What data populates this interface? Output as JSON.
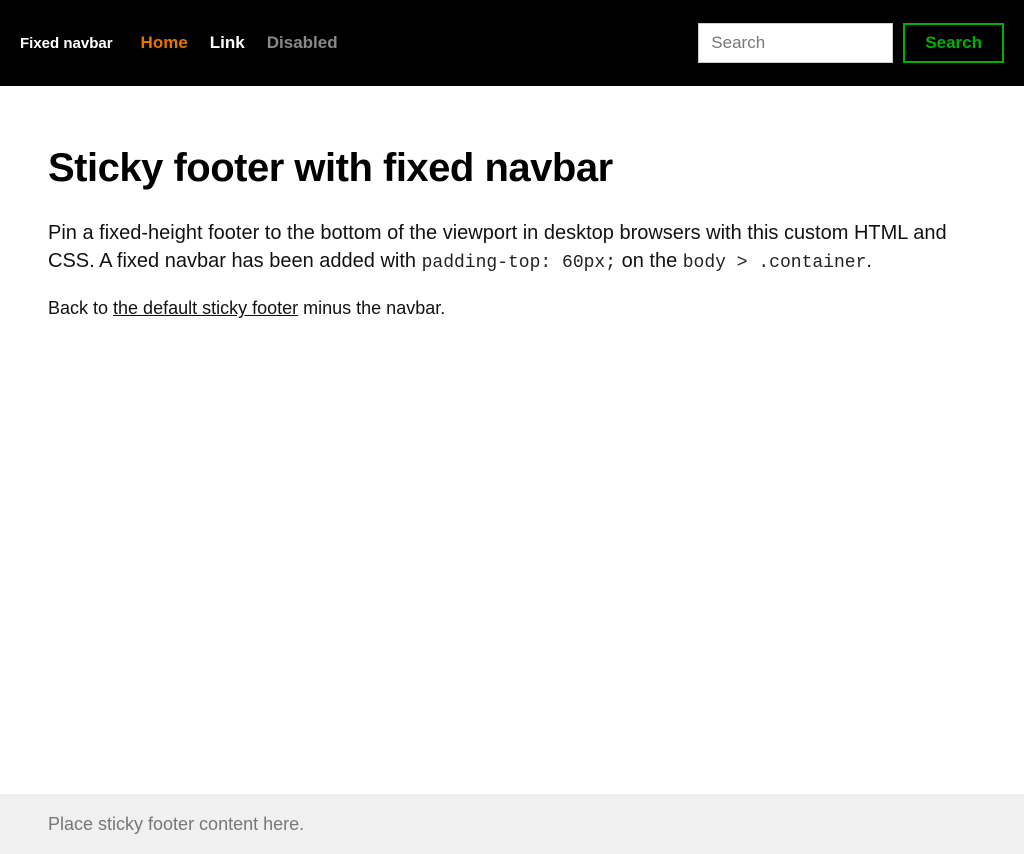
{
  "navbar": {
    "brand": "Fixed navbar",
    "links": [
      {
        "label": "Home",
        "state": "active"
      },
      {
        "label": "Link",
        "state": ""
      },
      {
        "label": "Disabled",
        "state": "disabled"
      }
    ],
    "search_placeholder": "Search",
    "search_button": "Search"
  },
  "main": {
    "title": "Sticky footer with fixed navbar",
    "lead_before_code1": "Pin a fixed-height footer to the bottom of the viewport in desktop browsers with this custom HTML and CSS. A fixed navbar has been added with ",
    "code1": "padding-top: 60px;",
    "lead_between": " on the ",
    "code2": "body > .container",
    "lead_after": ".",
    "back_before": "Back to ",
    "back_link": "the default sticky footer",
    "back_after": " minus the navbar."
  },
  "footer": {
    "text": "Place sticky footer content here."
  }
}
